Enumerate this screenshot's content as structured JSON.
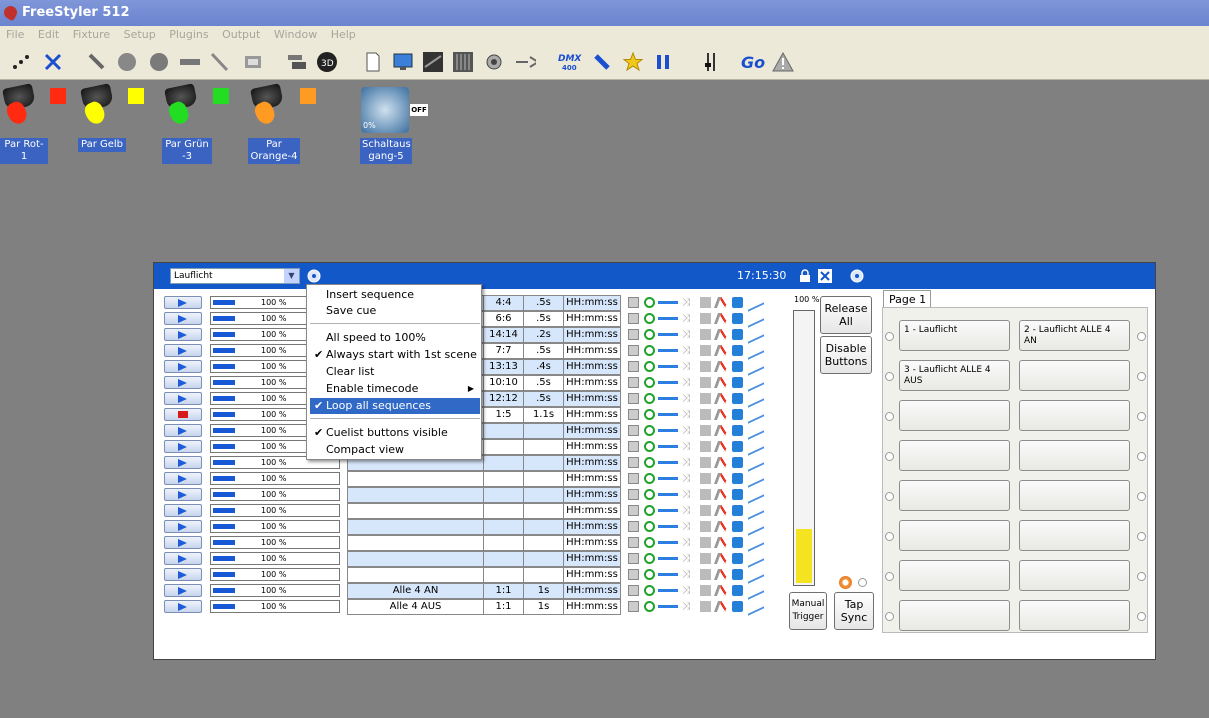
{
  "app": {
    "title": "FreeStyler 512"
  },
  "menu": [
    "File",
    "Edit",
    "Fixture",
    "Setup",
    "Plugins",
    "Output",
    "Window",
    "Help"
  ],
  "toolbar": {
    "dmx_label": "DMX",
    "dmx_sub": "400",
    "go_label": "Go"
  },
  "fixtures": [
    {
      "name": "Par Rot-1",
      "color": "#ff2a10"
    },
    {
      "name": "Par Gelb",
      "color": "#ffff00"
    },
    {
      "name": "Par Grün -3",
      "color": "#22dd22"
    },
    {
      "name": "Par Orange-4",
      "color": "#ff9a22"
    },
    {
      "name": "Schaltaus gang-5",
      "status": "OFF",
      "percent": "0%"
    }
  ],
  "cuelist": {
    "sequence": "Lauflicht",
    "clock": "17:15:30",
    "rows": [
      {
        "speed": "100 %",
        "name": "",
        "a": "4:4",
        "b": ".5s",
        "time": "HH:mm:ss",
        "playing": false
      },
      {
        "speed": "100 %",
        "name": "",
        "a": "6:6",
        "b": ".5s",
        "time": "HH:mm:ss",
        "playing": false
      },
      {
        "speed": "100 %",
        "name": "",
        "a": "14:14",
        "b": ".2s",
        "time": "HH:mm:ss",
        "playing": false
      },
      {
        "speed": "100 %",
        "name": "",
        "a": "7:7",
        "b": ".5s",
        "time": "HH:mm:ss",
        "playing": false
      },
      {
        "speed": "100 %",
        "name": "",
        "a": "13:13",
        "b": ".4s",
        "time": "HH:mm:ss",
        "playing": false
      },
      {
        "speed": "100 %",
        "name": "",
        "a": "10:10",
        "b": ".5s",
        "time": "HH:mm:ss",
        "playing": false
      },
      {
        "speed": "100 %",
        "name": "",
        "a": "12:12",
        "b": ".5s",
        "time": "HH:mm:ss",
        "playing": false
      },
      {
        "speed": "100 %",
        "name": "",
        "a": "1:5",
        "b": "1.1s",
        "time": "HH:mm:ss",
        "playing": true
      },
      {
        "speed": "100 %",
        "name": "",
        "a": "",
        "b": "",
        "time": "HH:mm:ss",
        "playing": false
      },
      {
        "speed": "100 %",
        "name": "",
        "a": "",
        "b": "",
        "time": "HH:mm:ss",
        "playing": false
      },
      {
        "speed": "100 %",
        "name": "",
        "a": "",
        "b": "",
        "time": "HH:mm:ss",
        "playing": false
      },
      {
        "speed": "100 %",
        "name": "",
        "a": "",
        "b": "",
        "time": "HH:mm:ss",
        "playing": false
      },
      {
        "speed": "100 %",
        "name": "",
        "a": "",
        "b": "",
        "time": "HH:mm:ss",
        "playing": false
      },
      {
        "speed": "100 %",
        "name": "",
        "a": "",
        "b": "",
        "time": "HH:mm:ss",
        "playing": false
      },
      {
        "speed": "100 %",
        "name": "",
        "a": "",
        "b": "",
        "time": "HH:mm:ss",
        "playing": false
      },
      {
        "speed": "100 %",
        "name": "",
        "a": "",
        "b": "",
        "time": "HH:mm:ss",
        "playing": false
      },
      {
        "speed": "100 %",
        "name": "",
        "a": "",
        "b": "",
        "time": "HH:mm:ss",
        "playing": false
      },
      {
        "speed": "100 %",
        "name": "",
        "a": "",
        "b": "",
        "time": "HH:mm:ss",
        "playing": false
      },
      {
        "speed": "100 %",
        "name": "Alle 4 AN",
        "a": "1:1",
        "b": "1s",
        "time": "HH:mm:ss",
        "playing": false
      },
      {
        "speed": "100 %",
        "name": "Alle 4 AUS",
        "a": "1:1",
        "b": "1s",
        "time": "HH:mm:ss",
        "playing": false
      }
    ],
    "master_pct": "100 %",
    "master_level": 0.2,
    "release_all": "Release All",
    "disable_buttons": "Disable Buttons",
    "manual_trigger": "Manual Trigger",
    "tap_sync": "Tap Sync"
  },
  "context_menu": [
    {
      "label": "Insert sequence",
      "checked": false
    },
    {
      "label": "Save cue",
      "checked": false
    },
    {
      "label": "All speed to 100%",
      "checked": false
    },
    {
      "label": "Always start with 1st scene",
      "checked": true
    },
    {
      "label": "Clear list",
      "checked": false
    },
    {
      "label": "Enable timecode",
      "checked": false,
      "submenu": true
    },
    {
      "label": "Loop all sequences",
      "checked": true,
      "highlighted": true
    },
    {
      "label": "Cuelist buttons visible",
      "checked": true
    },
    {
      "label": "Compact view",
      "checked": false
    }
  ],
  "page": {
    "tab": "Page 1",
    "buttons": [
      "1 - Lauflicht",
      "2 - Lauflicht ALLE 4 AN",
      "3 - Lauflicht ALLE 4 AUS",
      "",
      "",
      "",
      "",
      "",
      "",
      "",
      "",
      "",
      "",
      "",
      "",
      ""
    ]
  }
}
